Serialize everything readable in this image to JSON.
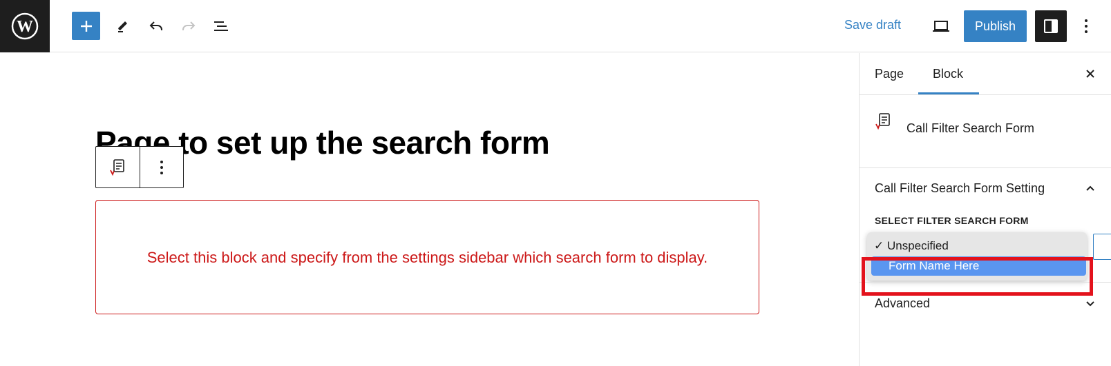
{
  "topbar": {
    "save_draft_label": "Save draft",
    "publish_label": "Publish"
  },
  "editor": {
    "page_title": "Page to set up the search form",
    "placeholder_text": "Select this block and specify from the settings sidebar which search form to display."
  },
  "sidebar": {
    "tabs": [
      {
        "label": "Page",
        "active": false
      },
      {
        "label": "Block",
        "active": true
      }
    ],
    "block_card_title": "Call Filter Search Form",
    "panel_title": "Call Filter Search Form Setting",
    "select_label": "SELECT FILTER SEARCH FORM",
    "select_options": [
      {
        "label": "Unspecified",
        "checked": true,
        "highlighted": false
      },
      {
        "label": "Form Name Here",
        "checked": false,
        "highlighted": true
      }
    ],
    "advanced_label": "Advanced"
  },
  "icons": {
    "wordpress_logo": "wordpress-logo-icon",
    "add": "plus-icon",
    "tools": "pencil-icon",
    "undo": "undo-icon",
    "redo": "redo-icon",
    "list_view": "list-view-icon",
    "preview": "desktop-preview-icon",
    "settings": "sidebar-toggle-icon",
    "options": "vertical-ellipsis-icon",
    "close": "close-icon",
    "block": "search-form-block-icon",
    "collapse": "chevron-up-icon",
    "expand": "chevron-down-icon"
  },
  "colors": {
    "accent": "#3582c4",
    "error": "#cc1818",
    "highlight": "#e3121c",
    "selected_option": "#5a96f0"
  }
}
